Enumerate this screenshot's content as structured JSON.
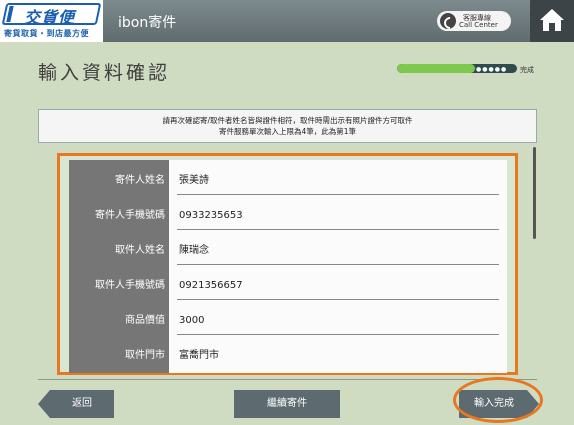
{
  "header": {
    "logo_title": "交貨便",
    "logo_subtitle": "寄貨取貨・到店最方便",
    "app_title": "ibon寄件",
    "call_center_line1": "客服專線",
    "call_center_line2": "Call Center"
  },
  "page": {
    "title": "輸入資料確認",
    "progress_label": "完成",
    "progress_dots": "●●●●●",
    "progress_fraction": 0.65
  },
  "notice": {
    "line1": "請再次確認寄/取件者姓名皆與證件相符，取件時需出示有照片證件方可取件",
    "line2": "寄件服務單次輸入上限為4筆，此為第1筆"
  },
  "form": {
    "rows": [
      {
        "label": "寄件人姓名",
        "value": "張美詩"
      },
      {
        "label": "寄件人手機號碼",
        "value": "0933235653"
      },
      {
        "label": "取件人姓名",
        "value": "陳瑞念"
      },
      {
        "label": "取件人手機號碼",
        "value": "0921356657"
      },
      {
        "label": "商品價值",
        "value": "3000"
      },
      {
        "label": "取件門市",
        "value": "富喬門市"
      }
    ]
  },
  "footer": {
    "back_label": "返回",
    "continue_label": "繼續寄件",
    "finish_label": "輸入完成"
  },
  "colors": {
    "background": "#cfdcc2",
    "accent_orange": "#e87722",
    "brand_blue": "#1a5fb0",
    "progress_green": "#7ec850"
  }
}
